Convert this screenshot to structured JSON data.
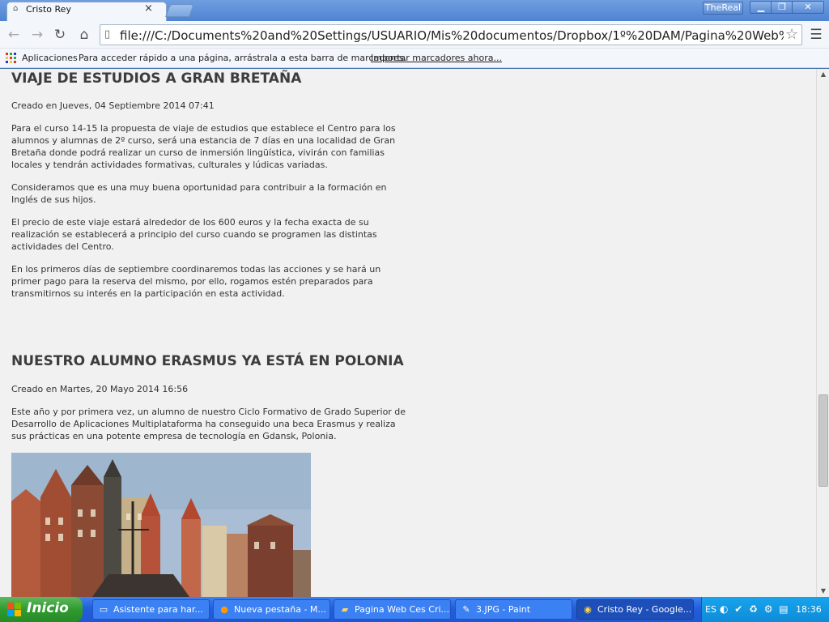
{
  "browser": {
    "tab_title": "Cristo Rey",
    "tab_favicon": "house-icon",
    "profile_label": "TheReal",
    "address": "file:///C:/Documents%20and%20Settings/USUARIO/Mis%20documentos/Dropbox/1º%20DAM/Pagina%20Web%2",
    "window_controls": [
      "minimize-icon",
      "restore-icon",
      "close-icon"
    ]
  },
  "bookmarks": {
    "apps_label": "Aplicaciones",
    "hint": "Para acceder rápido a una página, arrástrala a esta barra de marcadores.",
    "import_link": "Importar marcadores ahora..."
  },
  "articles": [
    {
      "title": "VIAJE DE ESTUDIOS A GRAN BRETAÑA",
      "meta": "Creado en Jueves, 04 Septiembre 2014 07:41",
      "paragraphs": [
        "Para el curso 14-15 la propuesta de viaje de estudios que establece el Centro para los alumnos y alumnas de 2º curso, será una estancia de 7 días en una localidad de Gran Bretaña donde podrá realizar un curso de inmersión lingüística, vivirán con familias locales y tendrán actividades formativas, culturales y lúdicas variadas.",
        "Consideramos que es una muy buena oportunidad para contribuir a la formación en Inglés de sus hijos.",
        "El precio de este viaje estará alrededor de los 600 euros y la fecha exacta de su realización se establecerá a principio del curso cuando se programen las distintas actividades del Centro.",
        "En los primeros días de septiembre coordinaremos todas las acciones y se hará un primer pago para la reserva del mismo, por ello, rogamos estén preparados para transmitirnos su interés en la participación en esta actividad."
      ]
    },
    {
      "title": "NUESTRO ALUMNO ERASMUS YA ESTÁ EN POLONIA",
      "meta": "Creado en Martes, 20 Mayo 2014 16:56",
      "paragraphs": [
        "Este año y por primera vez, un alumno de nuestro Ciclo Formativo de Grado Superior de Desarrollo de Aplicaciones Multiplataforma ha conseguido una beca Erasmus y realiza sus prácticas en una potente empresa de tecnología en Gdansk, Polonia."
      ]
    }
  ],
  "taskbar": {
    "start_label": "Inicio",
    "items": [
      {
        "label": "Asistente para har...",
        "icon": "window-icon"
      },
      {
        "label": "Nueva pestaña - M...",
        "icon": "firefox-icon"
      },
      {
        "label": "Pagina Web Ces Cri...",
        "icon": "folder-icon"
      },
      {
        "label": "3.JPG - Paint",
        "icon": "paint-icon"
      },
      {
        "label": "Cristo Rey - Google...",
        "icon": "chrome-icon"
      }
    ],
    "language": "ES",
    "clock": "18:36"
  }
}
